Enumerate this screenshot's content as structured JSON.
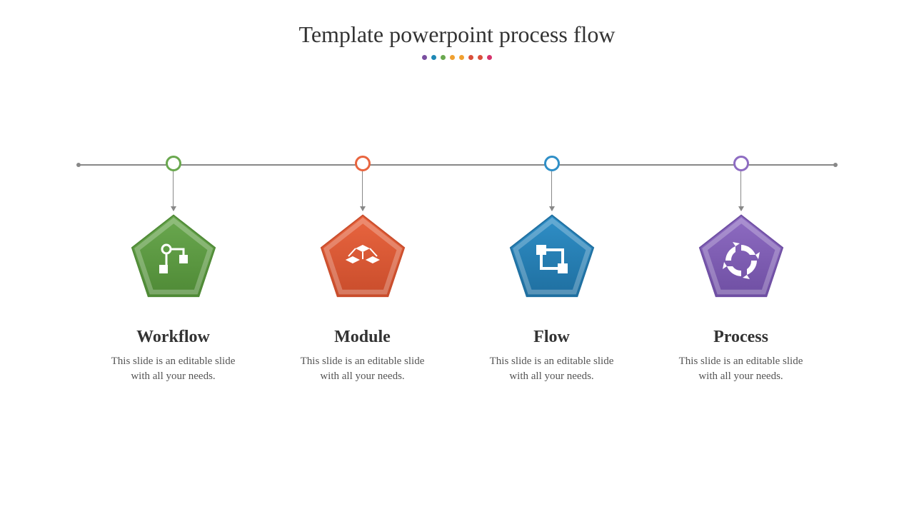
{
  "title": "Template powerpoint process flow",
  "decor_dots": [
    "#7a4fa0",
    "#1e88b5",
    "#6aa84f",
    "#f0a030",
    "#f0a030",
    "#d94f3a",
    "#d94f3a",
    "#d6336c"
  ],
  "steps": [
    {
      "label": "Workflow",
      "desc": "This slide is an editable slide with all your needs.",
      "color": "#6aa84f",
      "color_dark": "#4f8a36",
      "icon": "workflow-icon"
    },
    {
      "label": "Module",
      "desc": "This slide is an editable slide with all your needs.",
      "color": "#e9653f",
      "color_dark": "#c94d2c",
      "icon": "module-icon"
    },
    {
      "label": "Flow",
      "desc": "This slide is an editable slide with all your needs.",
      "color": "#2f8fc7",
      "color_dark": "#1f6fa0",
      "icon": "flow-icon"
    },
    {
      "label": "Process",
      "desc": "This slide is an editable slide with all your needs.",
      "color": "#8e6cc2",
      "color_dark": "#6f4fa3",
      "icon": "process-icon"
    }
  ]
}
